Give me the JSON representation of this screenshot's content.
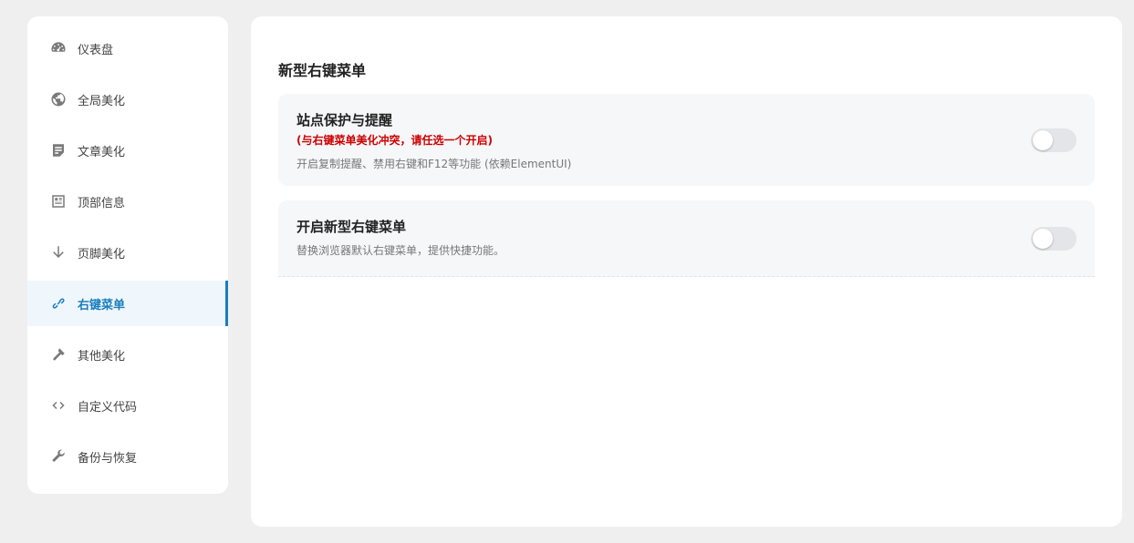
{
  "sidebar": {
    "items": [
      {
        "label": "仪表盘",
        "icon": "dashboard-icon",
        "active": false
      },
      {
        "label": "全局美化",
        "icon": "globe-icon",
        "active": false
      },
      {
        "label": "文章美化",
        "icon": "article-icon",
        "active": false
      },
      {
        "label": "顶部信息",
        "icon": "header-info-icon",
        "active": false
      },
      {
        "label": "页脚美化",
        "icon": "arrow-down-icon",
        "active": false
      },
      {
        "label": "右键菜单",
        "icon": "link-icon",
        "active": true
      },
      {
        "label": "其他美化",
        "icon": "hammer-icon",
        "active": false
      },
      {
        "label": "自定义代码",
        "icon": "code-icon",
        "active": false
      },
      {
        "label": "备份与恢复",
        "icon": "wrench-icon",
        "active": false
      }
    ]
  },
  "main": {
    "section_title": "新型右键菜单",
    "cards": [
      {
        "title": "站点保护与提醒",
        "warning": "(与右键菜单美化冲突，请任选一个开启)",
        "description": "开启复制提醒、禁用右键和F12等功能 (依赖ElementUI)",
        "enabled": false
      },
      {
        "title": "开启新型右键菜单",
        "description": "替换浏览器默认右键菜单，提供快捷功能。",
        "enabled": false
      }
    ]
  },
  "colors": {
    "accent": "#1a7ebd",
    "warning": "#cc0000",
    "background": "#efefef",
    "card_bg": "#f6f7f9"
  }
}
